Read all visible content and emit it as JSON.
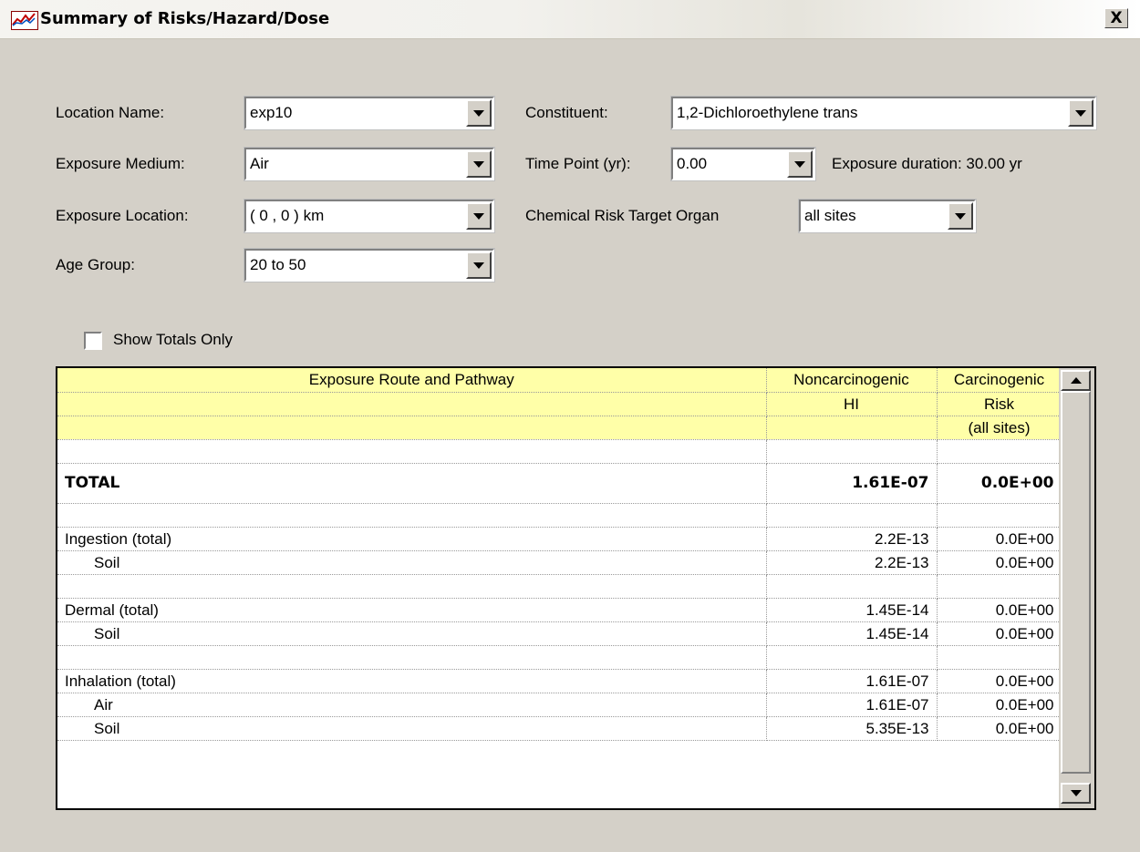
{
  "window": {
    "title": "Summary of Risks/Hazard/Dose",
    "close_glyph": "X"
  },
  "form": {
    "location_name": {
      "label": "Location Name:",
      "value": "exp10"
    },
    "exposure_medium": {
      "label": "Exposure Medium:",
      "value": "Air"
    },
    "exposure_location": {
      "label": "Exposure Location:",
      "value": "( 0 , 0 ) km"
    },
    "age_group": {
      "label": "Age Group:",
      "value": "20 to 50"
    },
    "constituent": {
      "label": "Constituent:",
      "value": "1,2-Dichloroethylene trans"
    },
    "time_point": {
      "label": "Time Point (yr):",
      "value": "0.00"
    },
    "exposure_duration": "Exposure duration: 30.00 yr",
    "target_organ": {
      "label": "Chemical Risk Target Organ",
      "value": "all sites"
    },
    "show_totals_only": {
      "label": "Show Totals Only",
      "checked": false
    }
  },
  "grid": {
    "header": {
      "route": "Exposure Route and Pathway",
      "noncarc": "Noncarcinogenic",
      "carc": "Carcinogenic",
      "noncarc_sub": "HI",
      "carc_sub": "Risk",
      "carc_sub2": "(all sites)"
    },
    "rows": [
      {
        "label": "",
        "hi": "",
        "risk": ""
      },
      {
        "label": "TOTAL",
        "hi": "1.61E-07",
        "risk": "0.0E+00"
      },
      {
        "label": "",
        "hi": "",
        "risk": ""
      },
      {
        "label": "Ingestion (total)",
        "hi": "2.2E-13",
        "risk": "0.0E+00"
      },
      {
        "label": "Soil",
        "hi": "2.2E-13",
        "risk": "0.0E+00"
      },
      {
        "label": "",
        "hi": "",
        "risk": ""
      },
      {
        "label": "Dermal (total)",
        "hi": "1.45E-14",
        "risk": "0.0E+00"
      },
      {
        "label": "Soil",
        "hi": "1.45E-14",
        "risk": "0.0E+00"
      },
      {
        "label": "",
        "hi": "",
        "risk": ""
      },
      {
        "label": "Inhalation (total)",
        "hi": "1.61E-07",
        "risk": "0.0E+00"
      },
      {
        "label": "Air",
        "hi": "1.61E-07",
        "risk": "0.0E+00"
      },
      {
        "label": "Soil",
        "hi": "5.35E-13",
        "risk": "0.0E+00"
      }
    ]
  },
  "colors": {
    "dialog_bg": "#d4d0c8",
    "grid_header_bg": "#ffffa8"
  },
  "icons": {
    "title": "chart-icon",
    "close": "close-icon",
    "dropdown": "chevron-down-icon",
    "scroll_up": "arrow-up-icon",
    "scroll_down": "arrow-down-icon"
  }
}
